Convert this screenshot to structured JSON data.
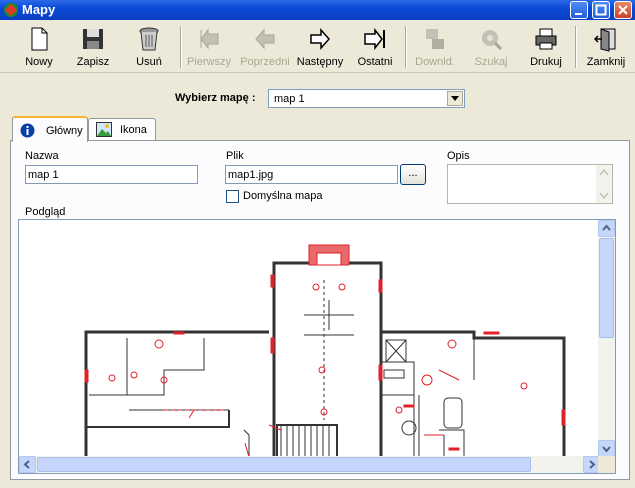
{
  "window": {
    "title": "Mapy"
  },
  "toolbar": {
    "new": "Nowy",
    "save": "Zapisz",
    "delete": "Usuń",
    "first": "Pierwszy",
    "previous": "Poprzedni",
    "next": "Następny",
    "last": "Ostatni",
    "download": "Downld.",
    "search": "Szukaj",
    "print": "Drukuj",
    "close": "Zamknij"
  },
  "selector": {
    "label": "Wybierz mapę :",
    "value": "map 1"
  },
  "tabs": [
    {
      "label": "Główny"
    },
    {
      "label": "Ikona"
    }
  ],
  "form": {
    "name_label": "Nazwa",
    "name_value": "map 1",
    "file_label": "Plik",
    "file_value": "map1.jpg",
    "browse_label": "...",
    "default_label": "Domyślna mapa",
    "default_checked": false,
    "description_label": "Opis",
    "description_value": ""
  },
  "preview": {
    "label": "Podgląd"
  },
  "colors": {
    "accent": "#0a4bd8",
    "plan_red": "#e0202a"
  }
}
